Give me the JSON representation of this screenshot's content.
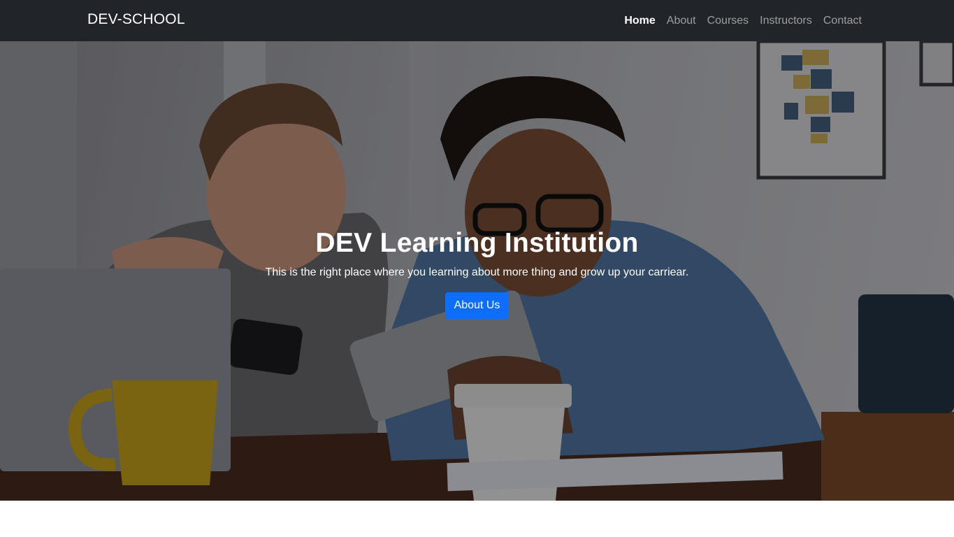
{
  "navbar": {
    "brand": "DEV-SCHOOL",
    "links": [
      {
        "label": "Home",
        "active": true
      },
      {
        "label": "About",
        "active": false
      },
      {
        "label": "Courses",
        "active": false
      },
      {
        "label": "Instructors",
        "active": false
      },
      {
        "label": "Contact",
        "active": false
      }
    ]
  },
  "hero": {
    "title": "DEV Learning Institution",
    "subtitle": "This is the right place where you learning about more thing and grow up your carriear.",
    "button_label": "About Us"
  },
  "colors": {
    "navbar_bg": "#212529",
    "primary": "#0d6efd",
    "text_light": "#ffffff",
    "nav_muted": "rgba(255,255,255,0.55)"
  }
}
